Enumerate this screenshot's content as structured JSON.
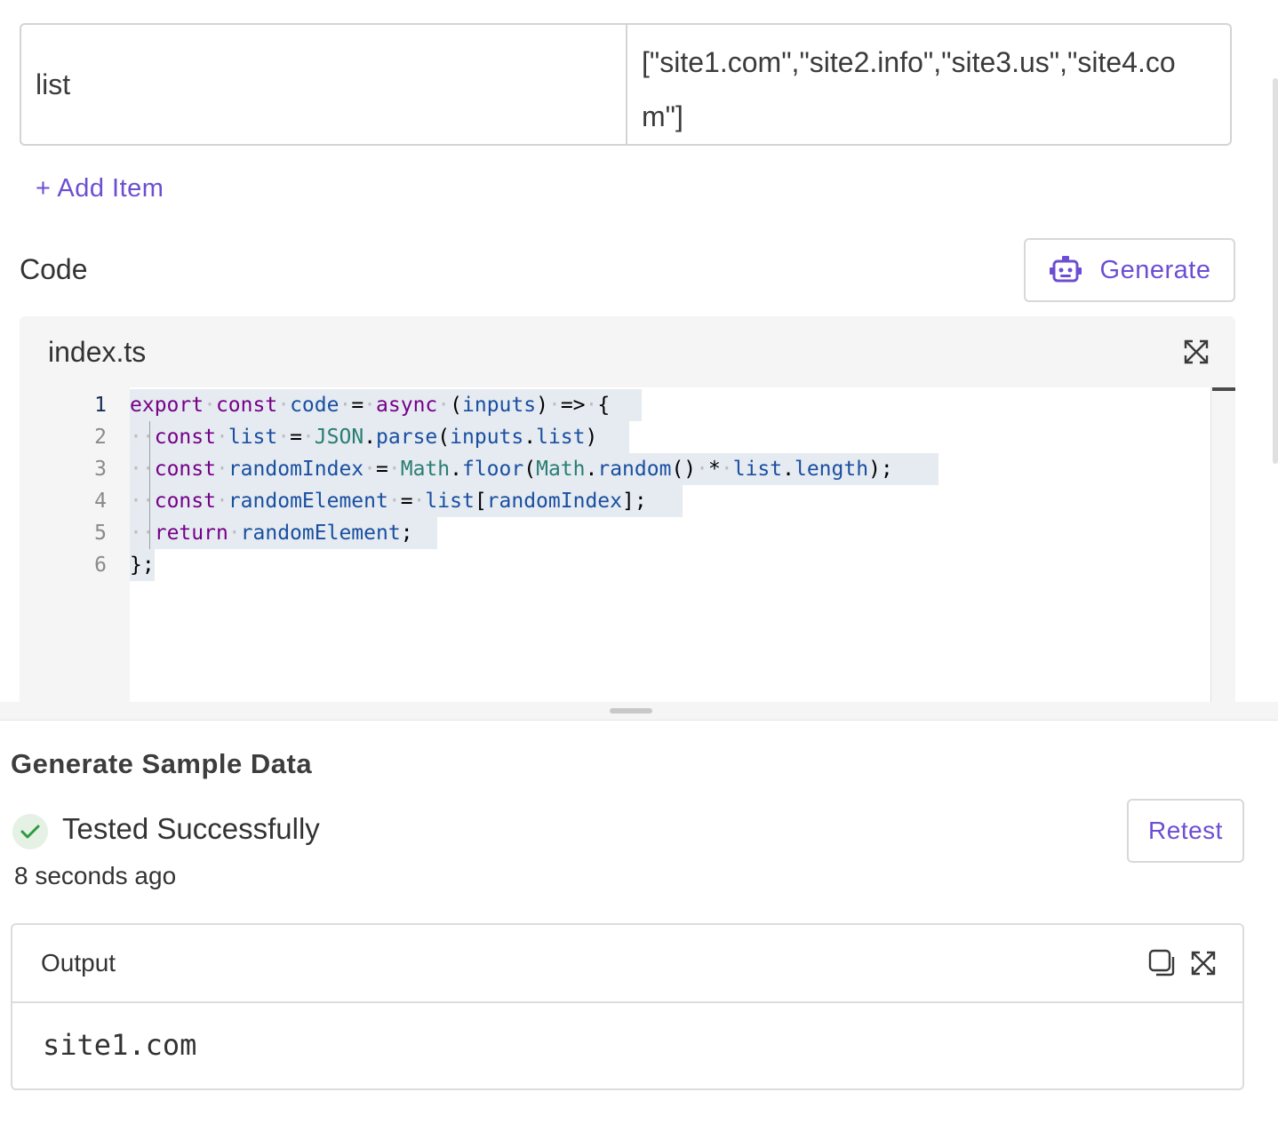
{
  "inputs_table": {
    "rows": [
      {
        "key": "list",
        "value": "[\"site1.com\",\"site2.info\",\"site3.us\",\"site4.com\"]"
      }
    ],
    "add_item_label": "+ Add Item"
  },
  "code_section": {
    "label": "Code",
    "generate_label": "Generate",
    "editor": {
      "filename": "index.ts",
      "line_numbers": [
        "1",
        "2",
        "3",
        "4",
        "5",
        "6"
      ],
      "lines": [
        "export const code = async (inputs) => {",
        "  const list = JSON.parse(inputs.list)",
        "  const randomIndex = Math.floor(Math.random() * list.length);",
        "  const randomElement = list[randomIndex];",
        "  return randomElement;",
        "};"
      ]
    }
  },
  "sample_data": {
    "title": "Generate Sample Data",
    "status": "Tested Successfully",
    "time_ago": "8 seconds ago",
    "retest_label": "Retest",
    "output": {
      "title": "Output",
      "value": "site1.com"
    }
  },
  "colors": {
    "accent": "#6c4ed3",
    "success": "#2e9a3e",
    "success_bg": "#e4f1e4"
  }
}
